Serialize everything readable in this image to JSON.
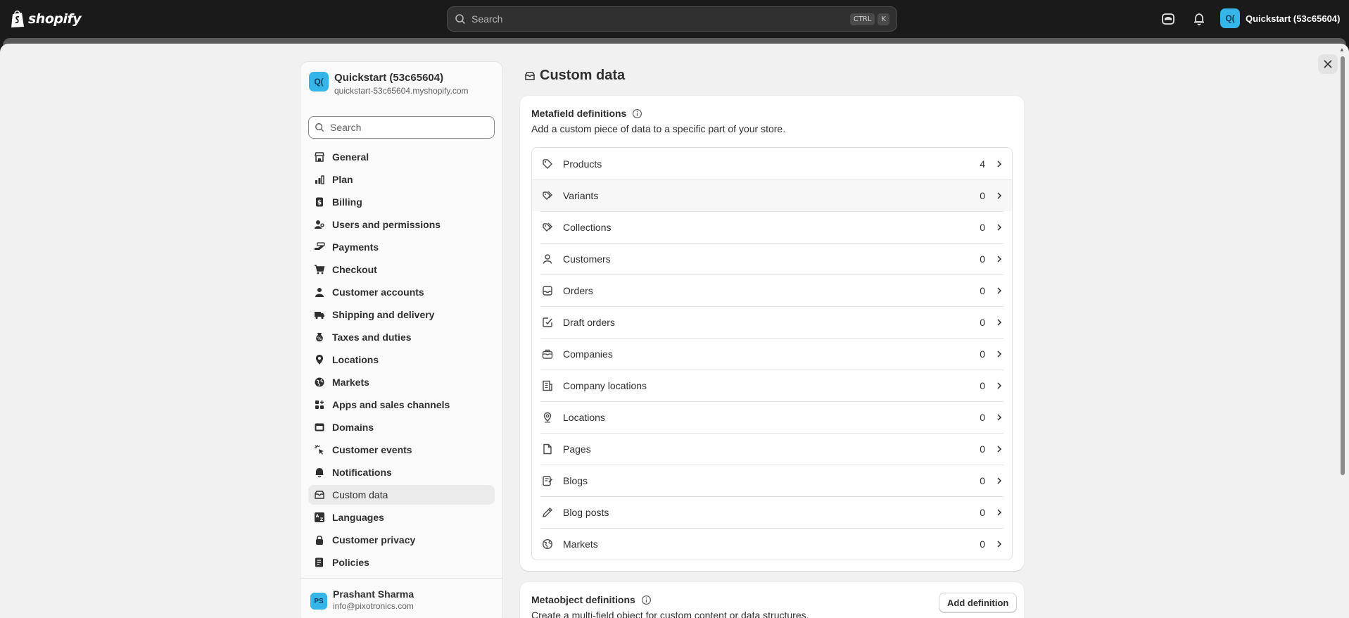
{
  "topbar": {
    "logo_text": "shopify",
    "search_placeholder": "Search",
    "shortcut_key1": "CTRL",
    "shortcut_key2": "K",
    "store_initials": "Q(",
    "store_name": "Quickstart (53c65604)"
  },
  "sidebar": {
    "store_initials": "Q(",
    "store_name": "Quickstart (53c65604)",
    "store_domain": "quickstart-53c65604.myshopify.com",
    "search_placeholder": "Search",
    "items": [
      {
        "label": "General",
        "icon": "store-icon"
      },
      {
        "label": "Plan",
        "icon": "plan-icon"
      },
      {
        "label": "Billing",
        "icon": "billing-icon"
      },
      {
        "label": "Users and permissions",
        "icon": "users-icon"
      },
      {
        "label": "Payments",
        "icon": "payments-icon"
      },
      {
        "label": "Checkout",
        "icon": "cart-icon"
      },
      {
        "label": "Customer accounts",
        "icon": "person-icon"
      },
      {
        "label": "Shipping and delivery",
        "icon": "truck-icon"
      },
      {
        "label": "Taxes and duties",
        "icon": "tax-icon"
      },
      {
        "label": "Locations",
        "icon": "location-icon"
      },
      {
        "label": "Markets",
        "icon": "globe-icon"
      },
      {
        "label": "Apps and sales channels",
        "icon": "apps-icon"
      },
      {
        "label": "Domains",
        "icon": "domain-icon"
      },
      {
        "label": "Customer events",
        "icon": "cursor-icon"
      },
      {
        "label": "Notifications",
        "icon": "bell-icon"
      },
      {
        "label": "Custom data",
        "icon": "database-icon",
        "active": true
      },
      {
        "label": "Languages",
        "icon": "language-icon"
      },
      {
        "label": "Customer privacy",
        "icon": "lock-icon"
      },
      {
        "label": "Policies",
        "icon": "policy-icon"
      }
    ],
    "user": {
      "initials": "PS",
      "name": "Prashant Sharma",
      "email": "info@pixotronics.com"
    }
  },
  "main": {
    "title": "Custom data",
    "metafields": {
      "title": "Metafield definitions",
      "description": "Add a custom piece of data to a specific part of your store.",
      "rows": [
        {
          "label": "Products",
          "count": "4"
        },
        {
          "label": "Variants",
          "count": "0"
        },
        {
          "label": "Collections",
          "count": "0"
        },
        {
          "label": "Customers",
          "count": "0"
        },
        {
          "label": "Orders",
          "count": "0"
        },
        {
          "label": "Draft orders",
          "count": "0"
        },
        {
          "label": "Companies",
          "count": "0"
        },
        {
          "label": "Company locations",
          "count": "0"
        },
        {
          "label": "Locations",
          "count": "0"
        },
        {
          "label": "Pages",
          "count": "0"
        },
        {
          "label": "Blogs",
          "count": "0"
        },
        {
          "label": "Blog posts",
          "count": "0"
        },
        {
          "label": "Markets",
          "count": "0"
        }
      ]
    },
    "metaobjects": {
      "title": "Metaobject definitions",
      "description": "Create a multi-field object for custom content or data structures.",
      "add_button": "Add definition"
    }
  }
}
